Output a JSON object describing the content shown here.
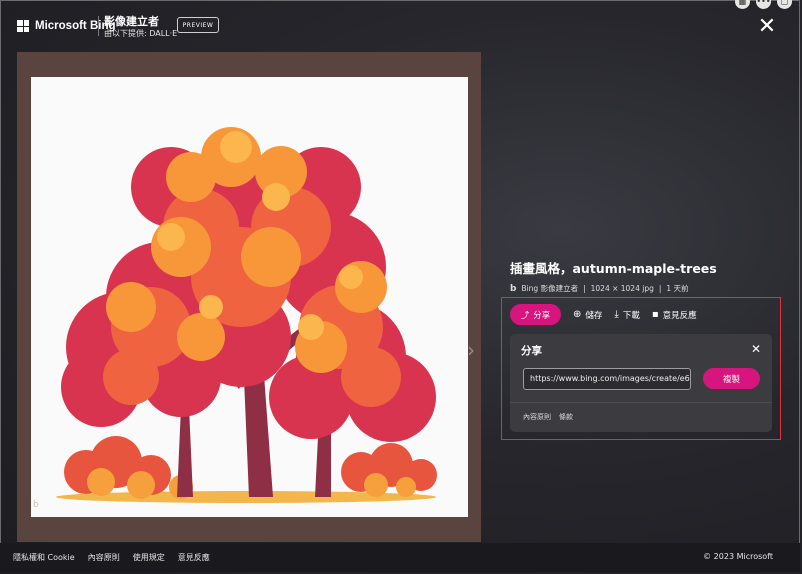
{
  "header": {
    "brand": "Microsoft Bing",
    "product_name": "影像建立者",
    "product_sub": "由以下提供: DALL·E",
    "preview_label": "PREVIEW"
  },
  "image": {
    "title": "插畫風格，autumn-maple-trees",
    "source": "Bing 影像建立者",
    "dimensions": "1024 × 1024 jpg",
    "age": "1 天前",
    "source_icon": "b"
  },
  "actions": {
    "share_label": "分享",
    "save_label": "儲存",
    "download_label": "下載",
    "feedback_label": "意見反應"
  },
  "share_panel": {
    "title": "分享",
    "url": "https://www.bing.com/images/create/e6",
    "copy_label": "複製",
    "links": [
      "內容原則",
      "條款"
    ]
  },
  "footer": {
    "links": [
      "隱私權和 Cookie",
      "內容原則",
      "使用規定",
      "意見反應"
    ],
    "copyright": "© 2023 Microsoft"
  },
  "icons": {
    "close": "✕",
    "share_panel_close": "✕",
    "next": "›",
    "share": "⤴",
    "save": "⊕",
    "download": "⤓",
    "feedback": "▪"
  },
  "colors": {
    "accent": "#d6157f",
    "highlight_border": "#e0313f"
  }
}
